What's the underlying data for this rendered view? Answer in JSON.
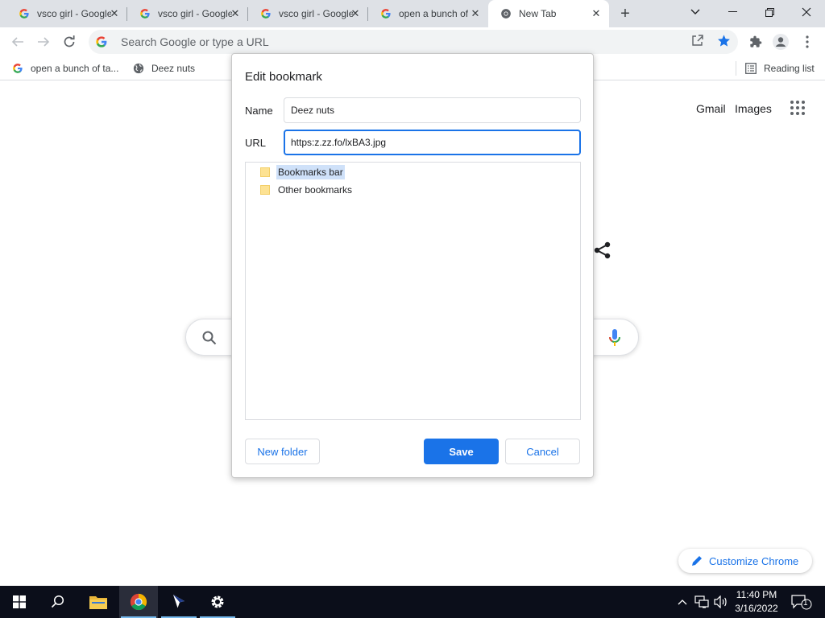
{
  "tabs": [
    {
      "title": "vsco girl - Google",
      "icon": "google-g-icon"
    },
    {
      "title": "vsco girl - Google",
      "icon": "google-g-icon"
    },
    {
      "title": "vsco girl - Google",
      "icon": "google-g-icon"
    },
    {
      "title": "open a bunch of tabs",
      "icon": "google-g-icon"
    },
    {
      "title": "New Tab",
      "icon": "chrome-icon"
    }
  ],
  "omnibox": {
    "placeholder": "Search Google or type a URL"
  },
  "bookmarks_bar": {
    "items": [
      {
        "label": "open a bunch of ta...",
        "icon": "google-g-icon"
      },
      {
        "label": "Deez nuts",
        "icon": "globe-icon"
      }
    ],
    "reading_list": "Reading list"
  },
  "page": {
    "gmail": "Gmail",
    "images": "Images",
    "customize": "Customize Chrome"
  },
  "dialog": {
    "title": "Edit bookmark",
    "name_label": "Name",
    "name_value": "Deez nuts",
    "url_label": "URL",
    "url_value": "https:z.zz.fo/lxBA3.jpg",
    "folders": [
      {
        "label": "Bookmarks bar",
        "selected": true
      },
      {
        "label": "Other bookmarks",
        "selected": false
      }
    ],
    "new_folder": "New folder",
    "save": "Save",
    "cancel": "Cancel"
  },
  "taskbar": {
    "time": "11:40 PM",
    "date": "3/16/2022",
    "notifications": "1"
  },
  "colors": {
    "accent": "#1a73e8",
    "tabstrip": "#dee1e6",
    "taskbar": "#0b0e1a"
  }
}
